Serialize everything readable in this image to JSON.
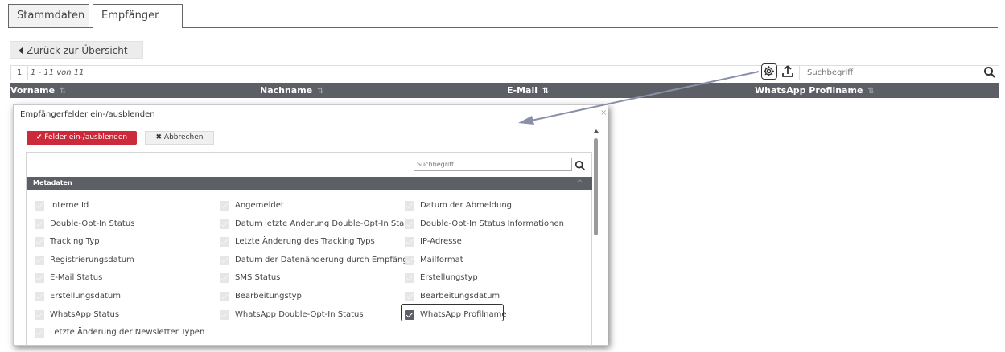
{
  "tabs": [
    {
      "label": "Stammdaten",
      "active": false
    },
    {
      "label": "Empfänger",
      "active": true
    }
  ],
  "back_button": {
    "label": "Zurück zur Übersicht"
  },
  "pager": {
    "page": "1",
    "range": "1 - 11 von 11"
  },
  "toolbar": {
    "gear_icon": "gear-icon",
    "upload_icon": "upload-icon",
    "search_placeholder": "Suchbegriff",
    "search_icon": "search-icon"
  },
  "columns": [
    {
      "label": "Vorname",
      "sort_icon": "⇅",
      "sort_active": false
    },
    {
      "label": "Nachname",
      "sort_icon": "⇅",
      "sort_active": false
    },
    {
      "label": "E-Mail",
      "sort_icon": "⇅",
      "sort_active": true
    },
    {
      "label": "WhatsApp Profilname",
      "sort_icon": "⇅",
      "sort_active": false
    }
  ],
  "dialog": {
    "title": "Empfängerfelder ein-/ausblenden",
    "close": "×",
    "apply_button": "✔ Felder ein-/ausblenden",
    "cancel_button": "✖ Abbrechen",
    "search_placeholder": "Suchbegriff",
    "section": {
      "label": "Metadaten",
      "chevron": "^"
    },
    "fields": [
      {
        "label": "Interne Id",
        "checked": false
      },
      {
        "label": "Angemeldet",
        "checked": false
      },
      {
        "label": "Datum der Abmeldung",
        "checked": false
      },
      {
        "label": "Double-Opt-In Status",
        "checked": false
      },
      {
        "label": "Datum letzte Änderung Double-Opt-In Sta...",
        "checked": false
      },
      {
        "label": "Double-Opt-In Status Informationen",
        "checked": false
      },
      {
        "label": "Tracking Typ",
        "checked": false
      },
      {
        "label": "Letzte Änderung des Tracking Typs",
        "checked": false
      },
      {
        "label": "IP-Adresse",
        "checked": false
      },
      {
        "label": "Registrierungsdatum",
        "checked": false
      },
      {
        "label": "Datum der Datenänderung durch Empfäng...",
        "checked": false
      },
      {
        "label": "Mailformat",
        "checked": false
      },
      {
        "label": "E-Mail Status",
        "checked": false
      },
      {
        "label": "SMS Status",
        "checked": false
      },
      {
        "label": "Erstellungstyp",
        "checked": false
      },
      {
        "label": "Erstellungsdatum",
        "checked": false
      },
      {
        "label": "Bearbeitungstyp",
        "checked": false
      },
      {
        "label": "Bearbeitungsdatum",
        "checked": false
      },
      {
        "label": "WhatsApp Status",
        "checked": false
      },
      {
        "label": "WhatsApp Double-Opt-In Status",
        "checked": false
      },
      {
        "label": "WhatsApp Profilname",
        "checked": true
      },
      {
        "label": "Letzte Änderung der Newsletter Typen",
        "checked": false
      }
    ]
  },
  "colors": {
    "header_bg": "#5d5f66",
    "apply_button_bg": "#cc2a3a",
    "annotation_arrow": "#8a8fa8"
  }
}
